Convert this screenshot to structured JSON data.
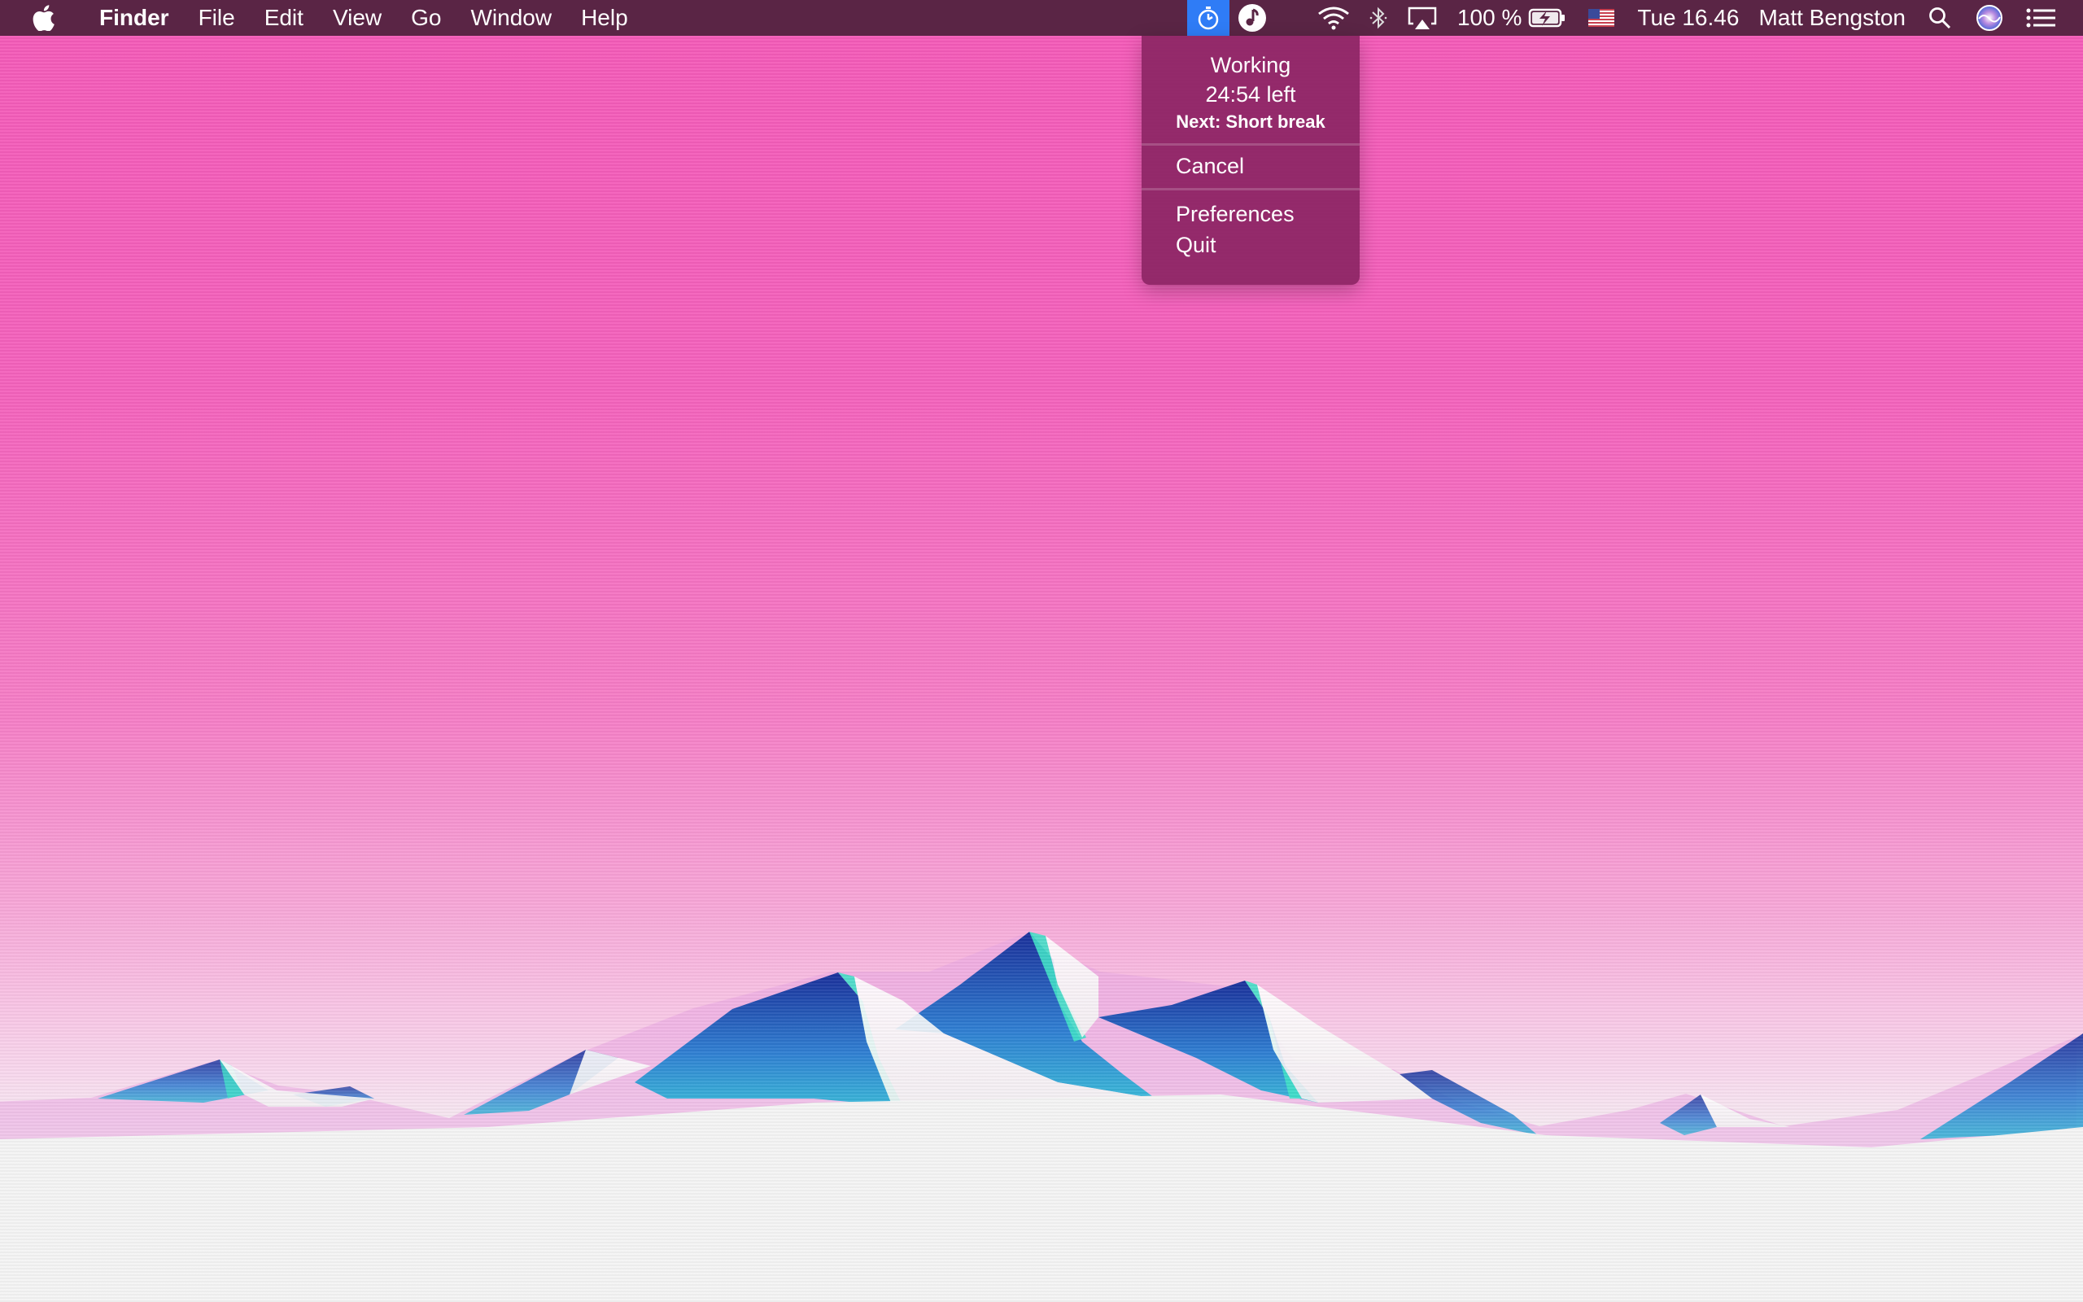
{
  "menubar": {
    "app_name": "Finder",
    "menus": [
      "File",
      "Edit",
      "View",
      "Go",
      "Window",
      "Help"
    ],
    "status": {
      "timer_icon": "stopwatch-icon",
      "music_icon": "music-note-icon",
      "wifi_icon": "wifi-icon",
      "bluetooth_icon": "bluetooth-icon",
      "airplay_icon": "airplay-icon",
      "battery_percent": "100 %",
      "battery_icon": "battery-charging-icon",
      "input_source_icon": "us-flag-icon",
      "clock": "Tue 16.46",
      "user": "Matt Bengston",
      "spotlight_icon": "search-icon",
      "siri_icon": "siri-icon",
      "notification_icon": "notification-center-icon"
    }
  },
  "timer_menu": {
    "state": "Working",
    "time_left": "24:54 left",
    "next": "Next: Short break",
    "cancel": "Cancel",
    "preferences": "Preferences",
    "quit": "Quit"
  },
  "colors": {
    "menubar_bg": "#5a2545",
    "active_status_bg": "#2f7cf6",
    "dropdown_bg": "#8c2664",
    "sky_top": "#f45ab8",
    "snow": "#f5f5f5",
    "mountain_dark": "#1d3fa0",
    "mountain_teal": "#3fd4c4"
  }
}
